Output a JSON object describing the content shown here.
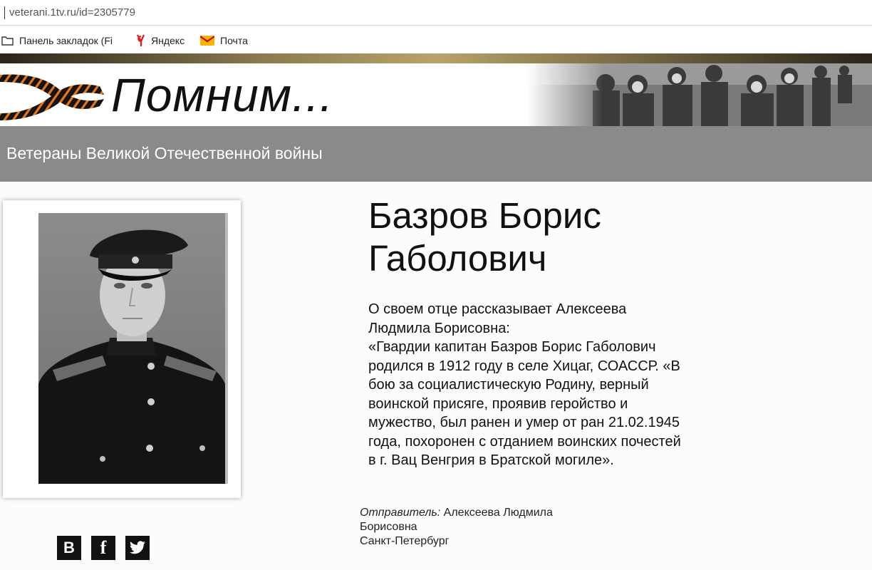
{
  "browser": {
    "url": "veterani.1tv.ru/id=2305779",
    "bookmarks": [
      {
        "label": "Панель закладок (Fi",
        "icon": "folder-icon"
      },
      {
        "label": "Яндекс",
        "icon": "yandex-icon"
      },
      {
        "label": "Почта",
        "icon": "mail-icon"
      }
    ]
  },
  "header": {
    "title": "Помним...",
    "subtitle": "Ветераны Великой Отечественной войны"
  },
  "veteran": {
    "name_line1": "Базров Борис",
    "name_line2": "Габолович",
    "story": [
      "О своем отце рассказывает Алексеева",
      "Людмила Борисовна:",
      "«Гвардии капитан Базров Борис Габолович",
      "родился в 1912 году в селе Хицаг, СОАССР. «В",
      "бою за социалистическую Родину, верный",
      "воинской присяге, проявив геройство и",
      "мужество, был ранен и умер от ран 21.02.1945",
      "года, похоронен с отданием воинских почестей",
      "в г. Вац Венгрия в Братской могиле»."
    ]
  },
  "sender": {
    "label": "Отправитель:",
    "name_part1": "Алексеева Людмила",
    "name_part2": "Борисовна",
    "city": "Санкт-Петербург"
  },
  "social": {
    "vk": "В",
    "facebook": "f"
  },
  "colors": {
    "subtitle_bar": "#8a8a8a",
    "ribbon_orange": "#e8751a",
    "ribbon_black": "#111111"
  }
}
